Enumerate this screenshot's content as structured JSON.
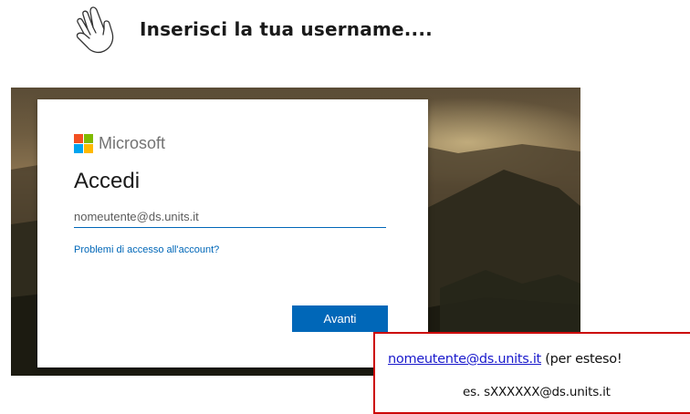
{
  "slide": {
    "heading": "Inserisci la tua username....",
    "icon": "pointing-hand-icon"
  },
  "signin_card": {
    "brand": "Microsoft",
    "title": "Accedi",
    "username_input": {
      "value": "",
      "placeholder": "nomeutente@ds.units.it"
    },
    "trouble_link": "Problemi di accesso all'account?",
    "next_button": "Avanti"
  },
  "note": {
    "email": "nomeutente@ds.units.it",
    "email_suffix": " (per esteso!",
    "example": "es. sXXXXXX@ds.units.it",
    "border_color": "#cc0000"
  },
  "colors": {
    "accent": "#0067b8",
    "logo_red": "#f25022",
    "logo_green": "#7fba00",
    "logo_blue": "#00a4ef",
    "logo_yellow": "#ffb900"
  }
}
